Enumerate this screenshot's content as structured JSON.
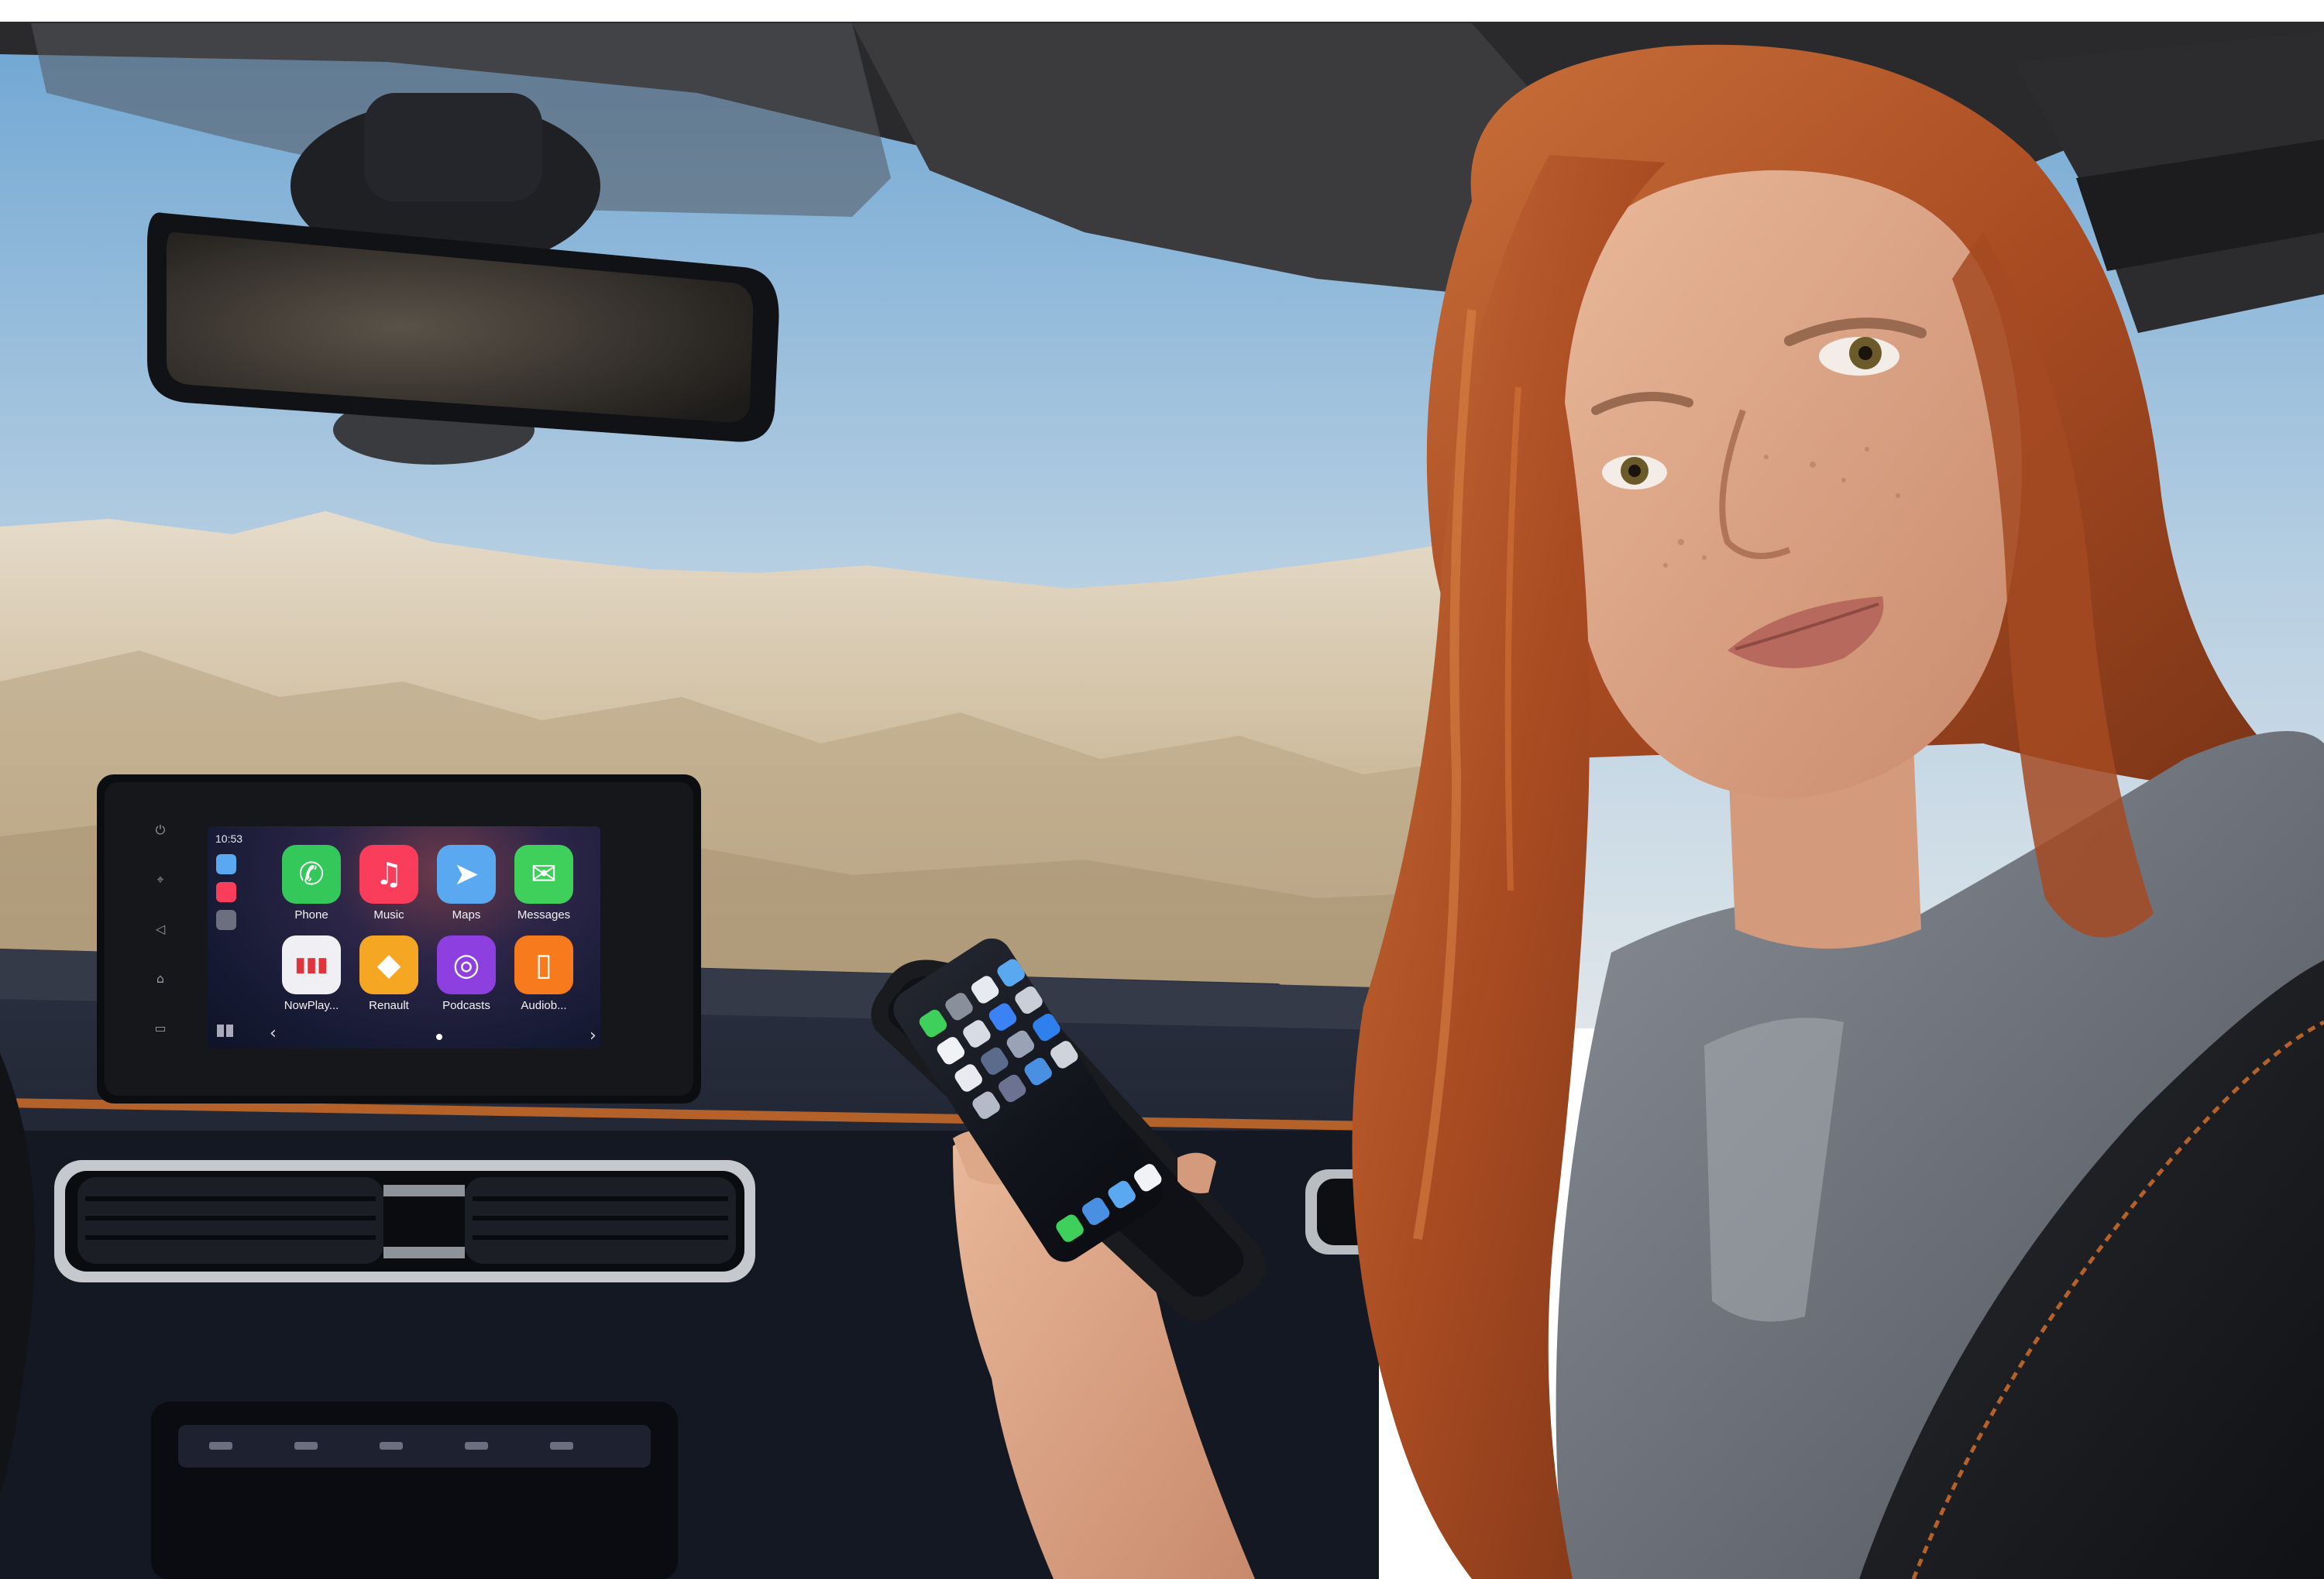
{
  "image": {
    "description_colors": {
      "sky_top": "#7fb0d6",
      "sky_bottom": "#d8e3ea",
      "mountains": "#c8b9a0",
      "dashboard": "#1a1e28",
      "accent_trim": "#b5612a",
      "hair": "#b5562a",
      "shirt": "#6c7178"
    }
  },
  "carplay": {
    "time": "10:53",
    "apps": [
      {
        "label": "Phone",
        "icon": "phone-icon",
        "color": "#34c759",
        "glyph": "✆"
      },
      {
        "label": "Music",
        "icon": "music-icon",
        "color": "#fa3d5a",
        "glyph": "♫"
      },
      {
        "label": "Maps",
        "icon": "maps-icon",
        "color": "#5aa9f0",
        "glyph": "➤"
      },
      {
        "label": "Messages",
        "icon": "messages-icon",
        "color": "#3fd05c",
        "glyph": "✉"
      },
      {
        "label": "NowPlay...",
        "icon": "now-playing-icon",
        "color": "#f0eff4",
        "glyph": "▮▮▮"
      },
      {
        "label": "Renault",
        "icon": "renault-icon",
        "color": "#f5a623",
        "glyph": "◆"
      },
      {
        "label": "Podcasts",
        "icon": "podcasts-icon",
        "color": "#8e3fe0",
        "glyph": "◎"
      },
      {
        "label": "Audiob...",
        "icon": "audiobooks-icon",
        "color": "#f77b1c",
        "glyph": "▯"
      }
    ],
    "dock": [
      {
        "icon": "maps-small-icon",
        "color": "#5aa9f0"
      },
      {
        "icon": "music-small-icon",
        "color": "#fa3d5a"
      },
      {
        "icon": "podcasts-small-icon",
        "color": "#6b6f80"
      }
    ],
    "nav_left": "‹",
    "nav_right": "›"
  },
  "phone": {
    "home_icons": [
      "#3fd05c",
      "#8a8f9c",
      "#e7eaf0",
      "#5aa9f0",
      "#f1f2f6",
      "#d7dbe3",
      "#3b82f6",
      "#c9ced8",
      "#e8eaf0",
      "#5a6b8c",
      "#9aa3b5",
      "#2f80ed",
      "#b4bac7",
      "#6b7390",
      "#4a90e2",
      "#cfd4dc"
    ],
    "dock_icons": [
      "#3fd05c",
      "#4a90e2",
      "#5aa9f0",
      "#f1f2f6"
    ]
  }
}
